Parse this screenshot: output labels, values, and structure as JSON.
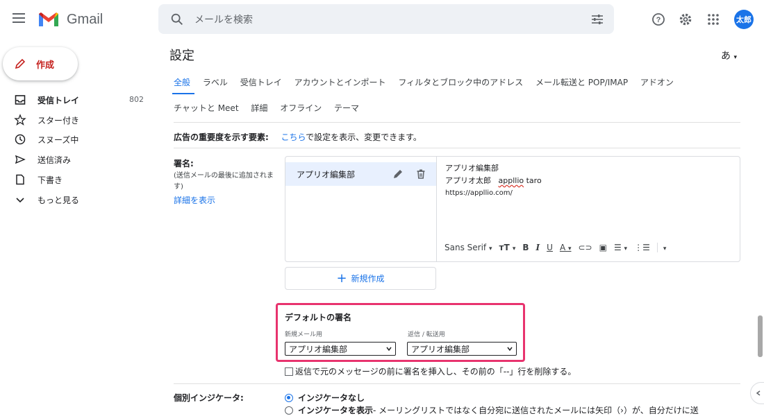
{
  "app": {
    "name": "Gmail",
    "brand_color": "#ea4335",
    "accent": "#1a73e8"
  },
  "search": {
    "placeholder": "メールを検索"
  },
  "avatar": {
    "initials": "太郎"
  },
  "compose": {
    "label": "作成"
  },
  "sidebar": {
    "items": [
      {
        "label": "受信トレイ",
        "count": "802",
        "icon": "inbox-icon",
        "bold": true
      },
      {
        "label": "スター付き",
        "icon": "star-icon"
      },
      {
        "label": "スヌーズ中",
        "icon": "clock-icon"
      },
      {
        "label": "送信済み",
        "icon": "send-icon"
      },
      {
        "label": "下書き",
        "icon": "draft-icon"
      },
      {
        "label": "もっと見る",
        "icon": "chevron-down-icon"
      }
    ]
  },
  "settings": {
    "title": "設定",
    "lang": "あ",
    "tabs_row1": [
      "全般",
      "ラベル",
      "受信トレイ",
      "アカウントとインポート",
      "フィルタとブロック中のアドレス",
      "メール転送と POP/IMAP",
      "アドオン"
    ],
    "tabs_row2": [
      "チャットと Meet",
      "詳細",
      "オフライン",
      "テーマ"
    ],
    "ads": {
      "label": "広告の重要度を示す要素:",
      "link": "こちら",
      "text": "で設定を表示、変更できます。"
    },
    "signature": {
      "label": "署名:",
      "desc": "(送信メールの最後に追加されます)",
      "details_link": "詳細を表示",
      "item_name": "アプリオ編集部",
      "editor_line1": "アプリオ編集部",
      "editor_line2a": "アプリオ太郎",
      "editor_line2b": "appllio",
      "editor_line2c": "taro",
      "editor_line3": "https://appllio.com/",
      "font": "Sans Serif",
      "new_button": "新規作成"
    },
    "default_sig": {
      "title": "デフォルトの署名",
      "new_mail_label": "新規メール用",
      "reply_label": "返信 / 転送用",
      "new_mail_value": "アプリオ編集部",
      "reply_value": "アプリオ編集部",
      "highlight_color": "#e8336e"
    },
    "insert_checkbox": "返信で元のメッセージの前に署名を挿入し、その前の「--」行を削除する。",
    "indicators": {
      "label": "個別インジケータ:",
      "option1": "インジケータなし",
      "option2_bold": "インジケータを表示",
      "option2_rest": " - メーリングリストではなく自分宛に送信されたメールには矢印（›）が、自分だけに送"
    }
  }
}
